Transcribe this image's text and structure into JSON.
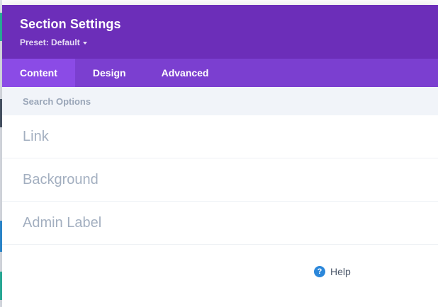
{
  "header": {
    "title": "Section Settings",
    "preset_label": "Preset: Default"
  },
  "tabs": [
    {
      "label": "Content",
      "active": true
    },
    {
      "label": "Design",
      "active": false
    },
    {
      "label": "Advanced",
      "active": false
    }
  ],
  "search": {
    "placeholder": "Search Options"
  },
  "options": [
    {
      "label": "Link"
    },
    {
      "label": "Background"
    },
    {
      "label": "Admin Label"
    }
  ],
  "help": {
    "label": "Help",
    "icon_glyph": "?",
    "icon": "question-circle-icon"
  },
  "colors": {
    "header": "#6c2eb9",
    "tab_bar": "#7b3fd0",
    "active_tab": "#8b4be6",
    "help_icon": "#2b87da"
  }
}
